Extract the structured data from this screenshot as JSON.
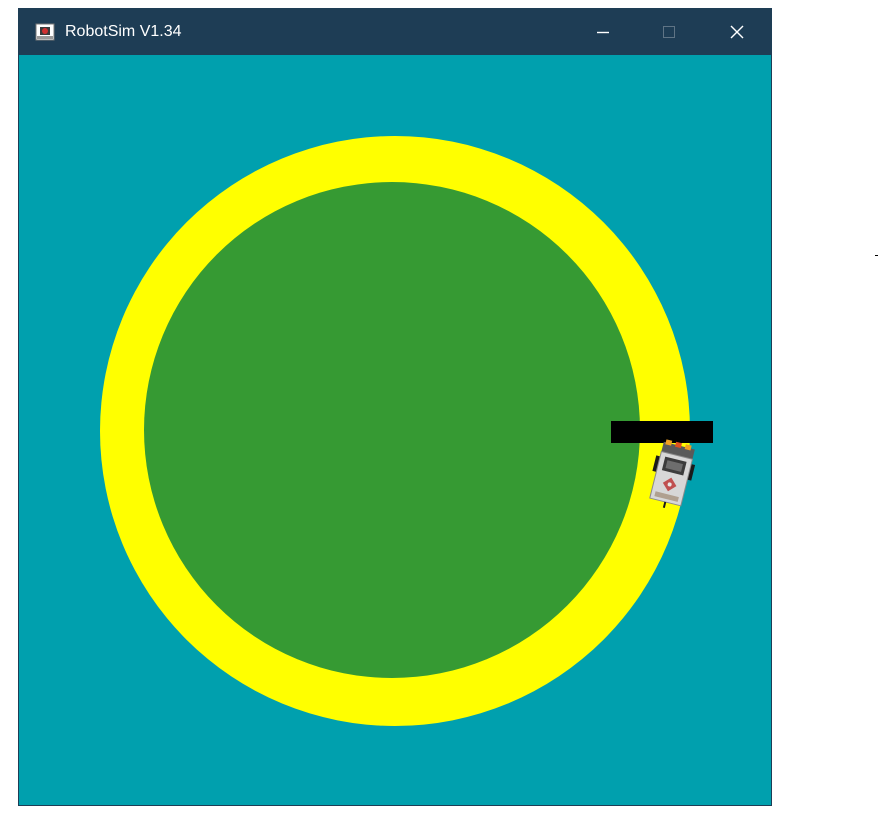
{
  "window": {
    "title": "RobotSim V1.34",
    "app_icon": "robot-app-icon",
    "controls": {
      "minimize": "minimize-icon",
      "maximize": "maximize-icon",
      "close": "close-icon"
    }
  },
  "scene": {
    "background_color": "#00a0ae",
    "ring_color": "#ffff00",
    "field_color": "#369a33",
    "obstacle_color": "#000000",
    "robot": "robot-sprite"
  },
  "colors": {
    "titlebar": "#1e3d55",
    "title_text": "#ffffff"
  }
}
